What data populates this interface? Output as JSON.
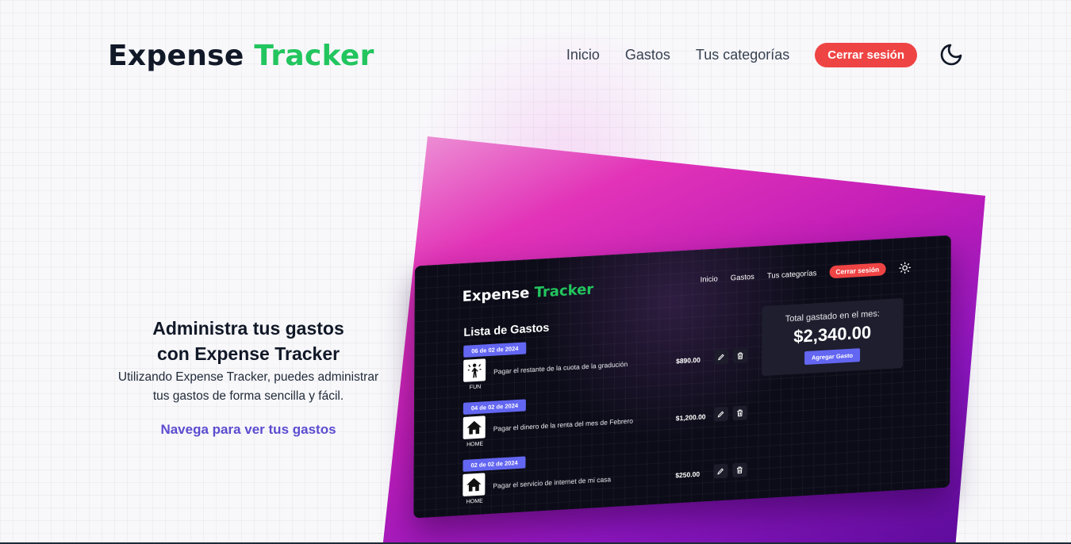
{
  "header": {
    "logo_part1": "Expense",
    "logo_part2": "Tracker",
    "nav": {
      "home": "Inicio",
      "expenses": "Gastos",
      "categories": "Tus categorías",
      "logout": "Cerrar sesión",
      "theme_icon": "moon-icon"
    }
  },
  "hero": {
    "title_line1": "Administra tus gastos",
    "title_line2": "con Expense Tracker",
    "desc_line1": "Utilizando Expense Tracker, puedes administrar",
    "desc_line2": "tus gastos de forma sencilla y fácil.",
    "cta": "Navega para ver tus gastos"
  },
  "preview": {
    "logo_part1": "Expense",
    "logo_part2": "Tracker",
    "nav": {
      "home": "Inicio",
      "expenses": "Gastos",
      "categories": "Tus categorías",
      "logout": "Cerrar sesión",
      "theme_icon": "sun-icon"
    },
    "list_title": "Lista de Gastos",
    "items": [
      {
        "date": "06 de 02 de 2024",
        "category": "FUN",
        "icon": "party-icon",
        "description": "Pagar el restante de la cuota de la gradución",
        "amount": "$890.00"
      },
      {
        "date": "04 de 02 de 2024",
        "category": "HOME",
        "icon": "house-icon",
        "description": "Pagar el dinero de la renta del mes de Febrero",
        "amount": "$1,200.00"
      },
      {
        "date": "02 de 02 de 2024",
        "category": "HOME",
        "icon": "house-icon",
        "description": "Pagar el servicio de internet de mi casa",
        "amount": "$250.00"
      }
    ],
    "total": {
      "label": "Total gastado en el mes:",
      "amount": "$2,340.00",
      "add_button": "Agregar Gasto"
    }
  },
  "colors": {
    "accent_green": "#22c55e",
    "logout_red": "#ef4444",
    "link_purple": "#5b4ccf",
    "badge_indigo": "#6366f1"
  }
}
